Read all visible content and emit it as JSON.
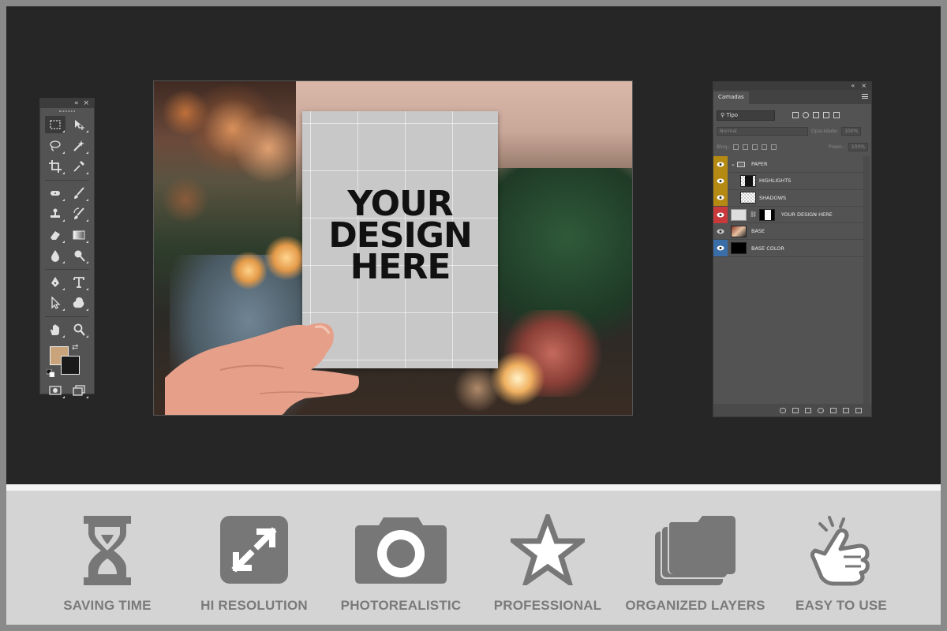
{
  "toolbar": {
    "collapse_glyph": "«",
    "close_glyph": "×",
    "foreground_color": "#c9a47a",
    "background_color": "#1a1a1a",
    "tools": [
      [
        "marquee-icon",
        "move-icon"
      ],
      [
        "lasso-icon",
        "magic-wand-icon"
      ],
      [
        "crop-icon",
        "eyedropper-icon"
      ],
      [
        "healing-brush-icon",
        "brush-icon"
      ],
      [
        "clone-stamp-icon",
        "history-brush-icon"
      ],
      [
        "eraser-icon",
        "gradient-icon"
      ],
      [
        "blur-icon",
        "dodge-icon"
      ],
      [
        "pen-icon",
        "type-icon"
      ],
      [
        "path-selection-icon",
        "custom-shape-icon"
      ],
      [
        "hand-icon",
        "zoom-icon"
      ]
    ]
  },
  "canvas": {
    "paper_line1": "YOUR",
    "paper_line2": "DESIGN",
    "paper_line3": "HERE"
  },
  "layers_panel": {
    "collapse_glyph": "«",
    "close_glyph": "×",
    "tab_label": "Camadas",
    "filter_label": "Tipo",
    "blend_mode": "Normal",
    "opacity_label": "Opacidade:",
    "opacity_value": "100%",
    "lock_label": "Bloq.:",
    "fill_label": "Preen.:",
    "fill_value": "100%",
    "layers": [
      {
        "name": "PAPER",
        "eye_color": "#b58a12",
        "type": "group"
      },
      {
        "name": "HIGHLIGHTS",
        "eye_color": "#b58a12",
        "type": "layer"
      },
      {
        "name": "SHADOWS",
        "eye_color": "#b58a12",
        "type": "layer"
      },
      {
        "name": "YOUR DESIGN HERE",
        "eye_color": "#c9383a",
        "type": "smart"
      },
      {
        "name": "BASE",
        "eye_color": "#535353",
        "type": "image"
      },
      {
        "name": "BASE COLOR",
        "eye_color": "#3a6ea8",
        "type": "fill"
      }
    ]
  },
  "features": [
    {
      "label": "SAVING TIME",
      "icon": "hourglass-icon"
    },
    {
      "label": "HI RESOLUTION",
      "icon": "expand-arrows-icon"
    },
    {
      "label": "PHOTOREALISTIC",
      "icon": "camera-icon"
    },
    {
      "label": "PROFESSIONAL",
      "icon": "star-icon"
    },
    {
      "label": "ORGANIZED LAYERS",
      "icon": "stacked-folders-icon"
    },
    {
      "label": "EASY TO USE",
      "icon": "tap-hand-icon"
    }
  ],
  "colors": {
    "workspace": "#262626",
    "panel": "#535353",
    "feature_gray": "#7a7a7a",
    "footer_bg": "#d4d4d4"
  }
}
